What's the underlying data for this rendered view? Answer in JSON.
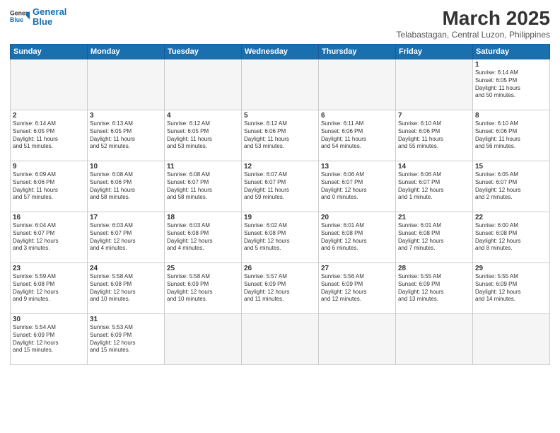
{
  "header": {
    "logo_general": "General",
    "logo_blue": "Blue",
    "month_title": "March 2025",
    "location": "Telabastagan, Central Luzon, Philippines"
  },
  "days_of_week": [
    "Sunday",
    "Monday",
    "Tuesday",
    "Wednesday",
    "Thursday",
    "Friday",
    "Saturday"
  ],
  "weeks": [
    [
      {
        "day": "",
        "info": "",
        "empty": true
      },
      {
        "day": "",
        "info": "",
        "empty": true
      },
      {
        "day": "",
        "info": "",
        "empty": true
      },
      {
        "day": "",
        "info": "",
        "empty": true
      },
      {
        "day": "",
        "info": "",
        "empty": true
      },
      {
        "day": "",
        "info": "",
        "empty": true
      },
      {
        "day": "1",
        "info": "Sunrise: 6:14 AM\nSunset: 6:05 PM\nDaylight: 11 hours\nand 50 minutes.",
        "empty": false
      }
    ],
    [
      {
        "day": "2",
        "info": "Sunrise: 6:14 AM\nSunset: 6:05 PM\nDaylight: 11 hours\nand 51 minutes.",
        "empty": false
      },
      {
        "day": "3",
        "info": "Sunrise: 6:13 AM\nSunset: 6:05 PM\nDaylight: 11 hours\nand 52 minutes.",
        "empty": false
      },
      {
        "day": "4",
        "info": "Sunrise: 6:12 AM\nSunset: 6:05 PM\nDaylight: 11 hours\nand 53 minutes.",
        "empty": false
      },
      {
        "day": "5",
        "info": "Sunrise: 6:12 AM\nSunset: 6:06 PM\nDaylight: 11 hours\nand 53 minutes.",
        "empty": false
      },
      {
        "day": "6",
        "info": "Sunrise: 6:11 AM\nSunset: 6:06 PM\nDaylight: 11 hours\nand 54 minutes.",
        "empty": false
      },
      {
        "day": "7",
        "info": "Sunrise: 6:10 AM\nSunset: 6:06 PM\nDaylight: 11 hours\nand 55 minutes.",
        "empty": false
      },
      {
        "day": "8",
        "info": "Sunrise: 6:10 AM\nSunset: 6:06 PM\nDaylight: 11 hours\nand 56 minutes.",
        "empty": false
      }
    ],
    [
      {
        "day": "9",
        "info": "Sunrise: 6:09 AM\nSunset: 6:06 PM\nDaylight: 11 hours\nand 57 minutes.",
        "empty": false
      },
      {
        "day": "10",
        "info": "Sunrise: 6:08 AM\nSunset: 6:06 PM\nDaylight: 11 hours\nand 58 minutes.",
        "empty": false
      },
      {
        "day": "11",
        "info": "Sunrise: 6:08 AM\nSunset: 6:07 PM\nDaylight: 11 hours\nand 58 minutes.",
        "empty": false
      },
      {
        "day": "12",
        "info": "Sunrise: 6:07 AM\nSunset: 6:07 PM\nDaylight: 11 hours\nand 59 minutes.",
        "empty": false
      },
      {
        "day": "13",
        "info": "Sunrise: 6:06 AM\nSunset: 6:07 PM\nDaylight: 12 hours\nand 0 minutes.",
        "empty": false
      },
      {
        "day": "14",
        "info": "Sunrise: 6:06 AM\nSunset: 6:07 PM\nDaylight: 12 hours\nand 1 minute.",
        "empty": false
      },
      {
        "day": "15",
        "info": "Sunrise: 6:05 AM\nSunset: 6:07 PM\nDaylight: 12 hours\nand 2 minutes.",
        "empty": false
      }
    ],
    [
      {
        "day": "16",
        "info": "Sunrise: 6:04 AM\nSunset: 6:07 PM\nDaylight: 12 hours\nand 3 minutes.",
        "empty": false
      },
      {
        "day": "17",
        "info": "Sunrise: 6:03 AM\nSunset: 6:07 PM\nDaylight: 12 hours\nand 4 minutes.",
        "empty": false
      },
      {
        "day": "18",
        "info": "Sunrise: 6:03 AM\nSunset: 6:08 PM\nDaylight: 12 hours\nand 4 minutes.",
        "empty": false
      },
      {
        "day": "19",
        "info": "Sunrise: 6:02 AM\nSunset: 6:08 PM\nDaylight: 12 hours\nand 5 minutes.",
        "empty": false
      },
      {
        "day": "20",
        "info": "Sunrise: 6:01 AM\nSunset: 6:08 PM\nDaylight: 12 hours\nand 6 minutes.",
        "empty": false
      },
      {
        "day": "21",
        "info": "Sunrise: 6:01 AM\nSunset: 6:08 PM\nDaylight: 12 hours\nand 7 minutes.",
        "empty": false
      },
      {
        "day": "22",
        "info": "Sunrise: 6:00 AM\nSunset: 6:08 PM\nDaylight: 12 hours\nand 8 minutes.",
        "empty": false
      }
    ],
    [
      {
        "day": "23",
        "info": "Sunrise: 5:59 AM\nSunset: 6:08 PM\nDaylight: 12 hours\nand 9 minutes.",
        "empty": false
      },
      {
        "day": "24",
        "info": "Sunrise: 5:58 AM\nSunset: 6:08 PM\nDaylight: 12 hours\nand 10 minutes.",
        "empty": false
      },
      {
        "day": "25",
        "info": "Sunrise: 5:58 AM\nSunset: 6:09 PM\nDaylight: 12 hours\nand 10 minutes.",
        "empty": false
      },
      {
        "day": "26",
        "info": "Sunrise: 5:57 AM\nSunset: 6:09 PM\nDaylight: 12 hours\nand 11 minutes.",
        "empty": false
      },
      {
        "day": "27",
        "info": "Sunrise: 5:56 AM\nSunset: 6:09 PM\nDaylight: 12 hours\nand 12 minutes.",
        "empty": false
      },
      {
        "day": "28",
        "info": "Sunrise: 5:55 AM\nSunset: 6:09 PM\nDaylight: 12 hours\nand 13 minutes.",
        "empty": false
      },
      {
        "day": "29",
        "info": "Sunrise: 5:55 AM\nSunset: 6:09 PM\nDaylight: 12 hours\nand 14 minutes.",
        "empty": false
      }
    ],
    [
      {
        "day": "30",
        "info": "Sunrise: 5:54 AM\nSunset: 6:09 PM\nDaylight: 12 hours\nand 15 minutes.",
        "empty": false
      },
      {
        "day": "31",
        "info": "Sunrise: 5:53 AM\nSunset: 6:09 PM\nDaylight: 12 hours\nand 15 minutes.",
        "empty": false
      },
      {
        "day": "",
        "info": "",
        "empty": true
      },
      {
        "day": "",
        "info": "",
        "empty": true
      },
      {
        "day": "",
        "info": "",
        "empty": true
      },
      {
        "day": "",
        "info": "",
        "empty": true
      },
      {
        "day": "",
        "info": "",
        "empty": true
      }
    ]
  ]
}
